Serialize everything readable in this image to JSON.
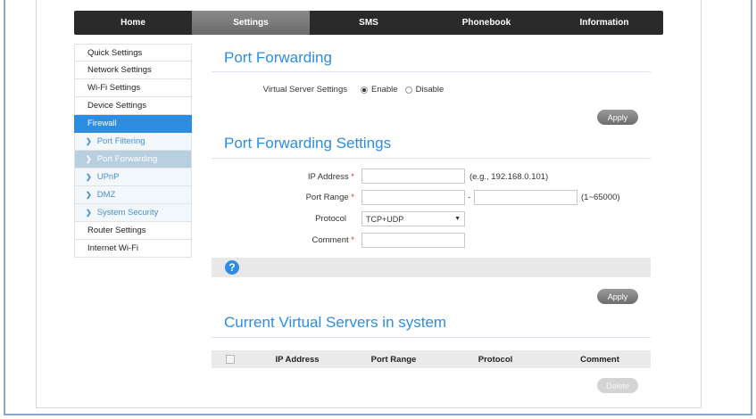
{
  "nav": {
    "tabs": [
      {
        "label": "Home"
      },
      {
        "label": "Settings"
      },
      {
        "label": "SMS"
      },
      {
        "label": "Phonebook"
      },
      {
        "label": "Information"
      }
    ],
    "active": "Settings"
  },
  "sidebar": {
    "items": [
      {
        "label": "Quick Settings"
      },
      {
        "label": "Network Settings"
      },
      {
        "label": "Wi-Fi Settings"
      },
      {
        "label": "Device Settings"
      },
      {
        "label": "Firewall"
      },
      {
        "label": "Port Filtering"
      },
      {
        "label": "Port Forwarding"
      },
      {
        "label": "UPnP"
      },
      {
        "label": "DMZ"
      },
      {
        "label": "System Security"
      },
      {
        "label": "Router Settings"
      },
      {
        "label": "Internet Wi-Fi"
      }
    ]
  },
  "port_forwarding": {
    "title": "Port Forwarding",
    "virtual_server_label": "Virtual Server Settings",
    "enable_label": "Enable",
    "disable_label": "Disable",
    "selected": "Enable",
    "apply_label": "Apply"
  },
  "settings": {
    "title": "Port Forwarding Settings",
    "ip_label": "IP Address",
    "ip_value": "",
    "ip_hint": "(e.g., 192.168.0.101)",
    "port_range_label": "Port Range",
    "port_from": "",
    "port_to": "",
    "port_sep": "-",
    "port_hint": "(1~65000)",
    "protocol_label": "Protocol",
    "protocol_value": "TCP+UDP",
    "comment_label": "Comment",
    "comment_value": "",
    "required_mark": "*",
    "help_icon": "question-icon",
    "apply_label": "Apply"
  },
  "servers": {
    "title": "Current Virtual Servers in system",
    "columns": [
      "IP Address",
      "Port Range",
      "Protocol",
      "Comment"
    ],
    "rows": [],
    "delete_label": "Delete"
  },
  "colors": {
    "accent": "#2d8de0",
    "nav_bg": "#2a2a2a",
    "required": "#e03030"
  }
}
